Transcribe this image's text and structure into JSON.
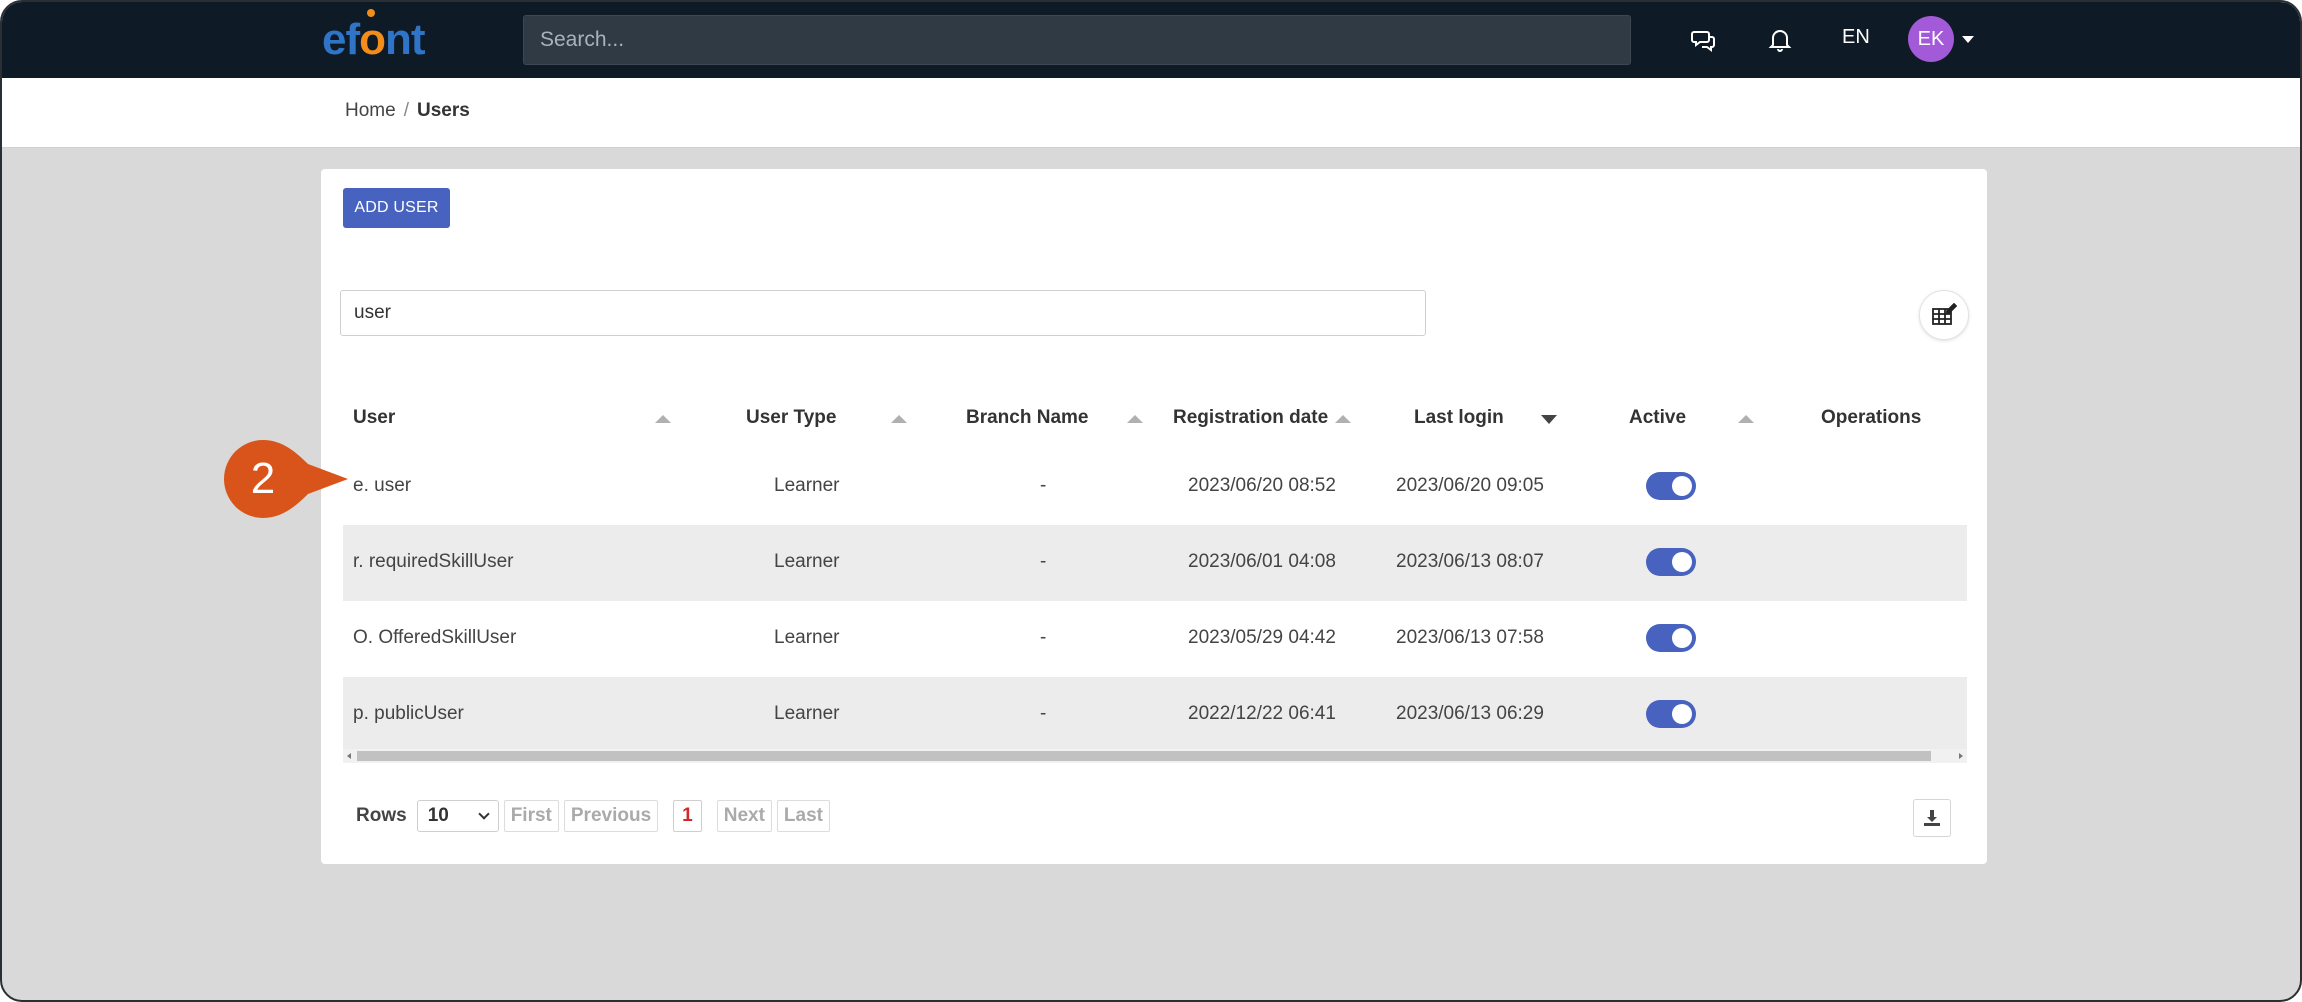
{
  "header": {
    "logo_text_left": "ef",
    "logo_text_o": "o",
    "logo_text_right": "nt",
    "search_placeholder": "Search...",
    "icons": [
      "chat-icon",
      "bell-icon"
    ],
    "language": "EN",
    "avatar_initials": "EK",
    "avatar_color": "#a35ad8"
  },
  "breadcrumb": {
    "home": "Home",
    "separator": "/",
    "current": "Users"
  },
  "toolbar": {
    "add_user_label": "ADD USER",
    "filter_value": "user",
    "columns_icon": "table-edit-icon"
  },
  "table": {
    "columns": {
      "user": "User",
      "user_type": "User Type",
      "branch_name": "Branch Name",
      "registration_date": "Registration date",
      "last_login": "Last login",
      "active": "Active",
      "operations": "Operations"
    },
    "sorted_column": "Last login",
    "rows": [
      {
        "user": "e. user",
        "user_type": "Learner",
        "branch_name": "-",
        "registration_date": "2023/06/20 08:52",
        "last_login": "2023/06/20 09:05",
        "active": true
      },
      {
        "user": "r. requiredSkillUser",
        "user_type": "Learner",
        "branch_name": "-",
        "registration_date": "2023/06/01 04:08",
        "last_login": "2023/06/13 08:07",
        "active": true
      },
      {
        "user": "O. OfferedSkillUser",
        "user_type": "Learner",
        "branch_name": "-",
        "registration_date": "2023/05/29 04:42",
        "last_login": "2023/06/13 07:58",
        "active": true
      },
      {
        "user": "p. publicUser",
        "user_type": "Learner",
        "branch_name": "-",
        "registration_date": "2022/12/22 06:41",
        "last_login": "2023/06/13 06:29",
        "active": true
      }
    ]
  },
  "pager": {
    "rows_label": "Rows",
    "rows_value": "10",
    "first": "First",
    "previous": "Previous",
    "current_page": "1",
    "next": "Next",
    "last": "Last",
    "download_icon": "download-icon"
  },
  "callout": {
    "number": "2",
    "color": "#d9541a"
  },
  "colors": {
    "topbar": "#0e1a26",
    "accent": "#4763bf",
    "page_bg": "#d9d9d9"
  }
}
